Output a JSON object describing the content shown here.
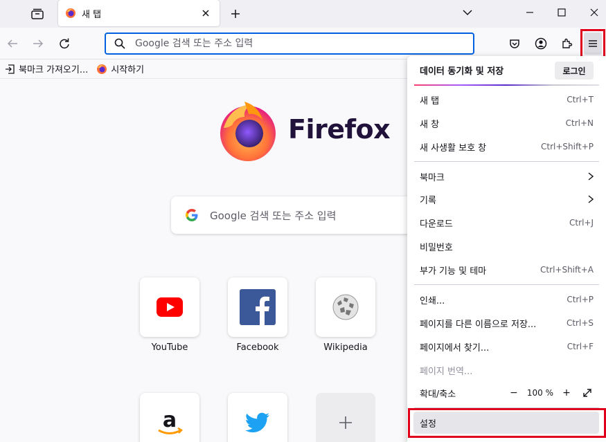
{
  "tab": {
    "title": "새 탭"
  },
  "urlbar": {
    "placeholder": "Google 검색 또는 주소 입력"
  },
  "bookmarks": [
    {
      "label": "북마크 가져오기..."
    },
    {
      "label": "시작하기"
    }
  ],
  "content": {
    "wordmark": "Firefox",
    "search_placeholder": "Google 검색 또는 주소 입력",
    "shortcuts": [
      {
        "label": "YouTube"
      },
      {
        "label": "Facebook"
      },
      {
        "label": "Wikipedia"
      }
    ]
  },
  "menu": {
    "header": "데이터 동기화 및 저장",
    "login": "로그인",
    "items": [
      {
        "label": "새 탭",
        "shortcut": "Ctrl+T"
      },
      {
        "label": "새 창",
        "shortcut": "Ctrl+N"
      },
      {
        "label": "새 사생활 보호 창",
        "shortcut": "Ctrl+Shift+P"
      },
      {
        "label": "북마크",
        "shortcut": ""
      },
      {
        "label": "기록",
        "shortcut": ""
      },
      {
        "label": "다운로드",
        "shortcut": "Ctrl+J"
      },
      {
        "label": "비밀번호",
        "shortcut": ""
      },
      {
        "label": "부가 기능 및 테마",
        "shortcut": "Ctrl+Shift+A"
      },
      {
        "label": "인쇄...",
        "shortcut": "Ctrl+P"
      },
      {
        "label": "페이지를 다른 이름으로 저장...",
        "shortcut": "Ctrl+S"
      },
      {
        "label": "페이지에서 찾기...",
        "shortcut": "Ctrl+F"
      },
      {
        "label": "페이지 번역...",
        "shortcut": ""
      },
      {
        "label": "확대/축소",
        "shortcut": ""
      },
      {
        "label": "설정",
        "shortcut": ""
      }
    ],
    "zoom": {
      "value": "100 %",
      "minus": "−",
      "plus": "+"
    }
  },
  "colors": {
    "accent": "#0061e0",
    "highlight": "#e0001b"
  }
}
